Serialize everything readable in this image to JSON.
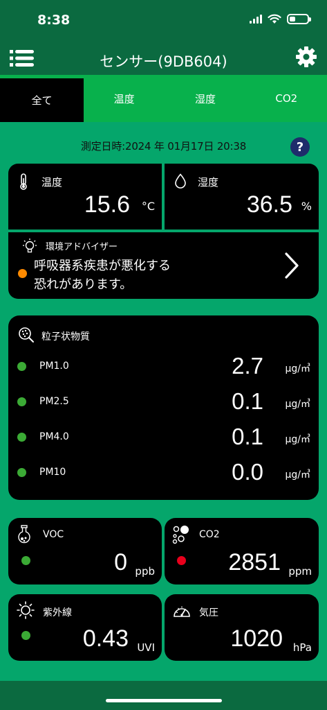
{
  "status": {
    "time": "8:38"
  },
  "header": {
    "title": "センサー(9DB604)"
  },
  "tabs": [
    "全て",
    "温度",
    "湿度",
    "CO2"
  ],
  "measure_date": "測定日時:2024 年 01月17日 20:38",
  "help": "?",
  "temperature": {
    "label": "温度",
    "value": "15.6",
    "unit": "°C"
  },
  "humidity": {
    "label": "湿度",
    "value": "36.5",
    "unit": "%"
  },
  "advisor": {
    "label": "環境アドバイザー",
    "line1": "呼吸器系疾患が悪化する",
    "line2": "恐れがあります。",
    "status_color": "#FF8A00"
  },
  "particles": {
    "label": "粒子状物質",
    "rows": [
      {
        "name": "PM1.0",
        "value": "2.7",
        "unit": "μg/㎥"
      },
      {
        "name": "PM2.5",
        "value": "0.1",
        "unit": "μg/㎥"
      },
      {
        "name": "PM4.0",
        "value": "0.1",
        "unit": "μg/㎥"
      },
      {
        "name": "PM10",
        "value": "0.0",
        "unit": "μg/㎥"
      }
    ],
    "status_color": "#3BAA35"
  },
  "voc": {
    "label": "VOC",
    "value": "0",
    "unit": "ppb",
    "status_color": "#3BAA35"
  },
  "co2": {
    "label": "CO2",
    "value": "2851",
    "unit": "ppm",
    "status_color": "#E8001C"
  },
  "uv": {
    "label": "紫外線",
    "value": "0.43",
    "unit": "UVI",
    "status_color": "#3BAA35"
  },
  "pressure": {
    "label": "気圧",
    "value": "1020",
    "unit": "hPa"
  },
  "colors": {
    "header_bg": "#0B6A40",
    "body_bg": "#05A66B",
    "tab_bg": "#08B14C",
    "card_bg": "#000000"
  }
}
